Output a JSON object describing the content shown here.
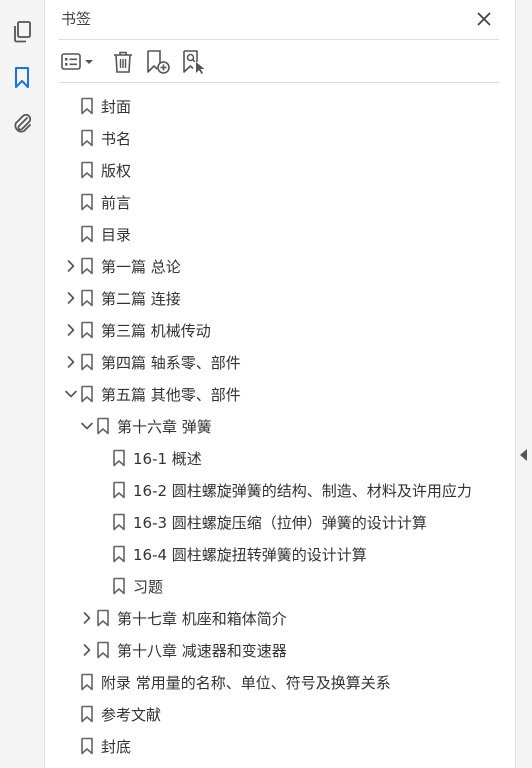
{
  "panel": {
    "title": "书签"
  },
  "rail": {
    "pages_icon": "pages-icon",
    "bookmarks_icon": "bookmark-icon",
    "attachments_icon": "paperclip-icon"
  },
  "toolbar": {
    "options_icon": "list-options-icon",
    "delete_icon": "trash-icon",
    "new_icon": "new-bookmark-icon",
    "find_icon": "find-bookmark-icon"
  },
  "colors": {
    "accent": "#1473e6",
    "icon": "#555555"
  },
  "bookmarks": [
    {
      "label": "封面",
      "level": 0,
      "expander": "none"
    },
    {
      "label": "书名",
      "level": 0,
      "expander": "none"
    },
    {
      "label": "版权",
      "level": 0,
      "expander": "none"
    },
    {
      "label": "前言",
      "level": 0,
      "expander": "none"
    },
    {
      "label": "目录",
      "level": 0,
      "expander": "none"
    },
    {
      "label": "第一篇  总论",
      "level": 0,
      "expander": "collapsed"
    },
    {
      "label": "第二篇  连接",
      "level": 0,
      "expander": "collapsed"
    },
    {
      "label": "第三篇  机械传动",
      "level": 0,
      "expander": "collapsed"
    },
    {
      "label": "第四篇  轴系零、部件",
      "level": 0,
      "expander": "collapsed"
    },
    {
      "label": "第五篇  其他零、部件",
      "level": 0,
      "expander": "expanded"
    },
    {
      "label": "第十六章  弹簧",
      "level": 1,
      "expander": "expanded"
    },
    {
      "label": "16-1  概述",
      "level": 2,
      "expander": "none"
    },
    {
      "label": "16-2  圆柱螺旋弹簧的结构、制造、材料及许用应力",
      "level": 2,
      "expander": "none"
    },
    {
      "label": "16-3  圆柱螺旋压缩（拉伸）弹簧的设计计算",
      "level": 2,
      "expander": "none"
    },
    {
      "label": "16-4  圆柱螺旋扭转弹簧的设计计算",
      "level": 2,
      "expander": "none"
    },
    {
      "label": "习题",
      "level": 2,
      "expander": "none"
    },
    {
      "label": "第十七章  机座和箱体简介",
      "level": 1,
      "expander": "collapsed"
    },
    {
      "label": "第十八章  减速器和变速器",
      "level": 1,
      "expander": "collapsed"
    },
    {
      "label": "附录  常用量的名称、单位、符号及换算关系",
      "level": 0,
      "expander": "none"
    },
    {
      "label": "参考文献",
      "level": 0,
      "expander": "none"
    },
    {
      "label": "封底",
      "level": 0,
      "expander": "none"
    }
  ]
}
